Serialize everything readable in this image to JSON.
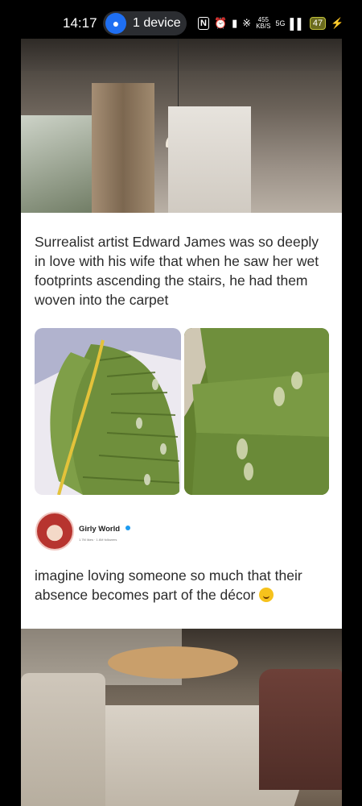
{
  "status_bar": {
    "time": "14:17",
    "device_pill": "1 device",
    "network_speed_value": "455",
    "network_speed_unit": "KB/S",
    "network_type": "5G",
    "battery": "47",
    "nfc_label": "N"
  },
  "post": {
    "headline": "Surrealist artist Edward James was so deeply in love with his wife that when he saw her wet footprints ascending the stairs, he had them woven into the carpet",
    "author_name": "Girly World",
    "author_stats": "1.7M likes · 1.6M followers",
    "caption": "imagine loving someone so much that their absence becomes part of the décor"
  },
  "colors": {
    "carpet_green": "#6f8f3c",
    "verified_blue": "#1d9bf0",
    "pill_blue": "#1f6ff2"
  }
}
